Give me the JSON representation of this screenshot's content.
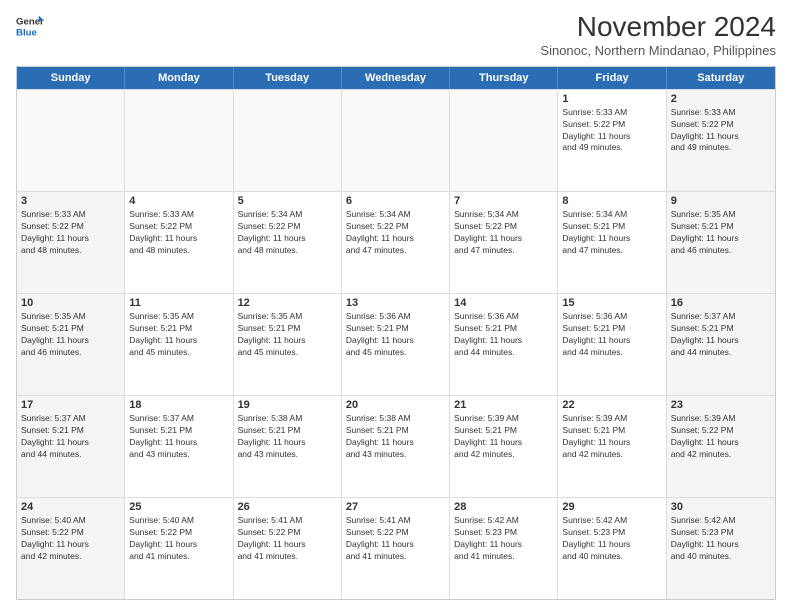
{
  "logo": {
    "line1": "General",
    "line2": "Blue"
  },
  "title": "November 2024",
  "location": "Sinonoc, Northern Mindanao, Philippines",
  "header_days": [
    "Sunday",
    "Monday",
    "Tuesday",
    "Wednesday",
    "Thursday",
    "Friday",
    "Saturday"
  ],
  "weeks": [
    [
      {
        "day": "",
        "info": ""
      },
      {
        "day": "",
        "info": ""
      },
      {
        "day": "",
        "info": ""
      },
      {
        "day": "",
        "info": ""
      },
      {
        "day": "",
        "info": ""
      },
      {
        "day": "1",
        "info": "Sunrise: 5:33 AM\nSunset: 5:22 PM\nDaylight: 11 hours\nand 49 minutes."
      },
      {
        "day": "2",
        "info": "Sunrise: 5:33 AM\nSunset: 5:22 PM\nDaylight: 11 hours\nand 49 minutes."
      }
    ],
    [
      {
        "day": "3",
        "info": "Sunrise: 5:33 AM\nSunset: 5:22 PM\nDaylight: 11 hours\nand 48 minutes."
      },
      {
        "day": "4",
        "info": "Sunrise: 5:33 AM\nSunset: 5:22 PM\nDaylight: 11 hours\nand 48 minutes."
      },
      {
        "day": "5",
        "info": "Sunrise: 5:34 AM\nSunset: 5:22 PM\nDaylight: 11 hours\nand 48 minutes."
      },
      {
        "day": "6",
        "info": "Sunrise: 5:34 AM\nSunset: 5:22 PM\nDaylight: 11 hours\nand 47 minutes."
      },
      {
        "day": "7",
        "info": "Sunrise: 5:34 AM\nSunset: 5:22 PM\nDaylight: 11 hours\nand 47 minutes."
      },
      {
        "day": "8",
        "info": "Sunrise: 5:34 AM\nSunset: 5:21 PM\nDaylight: 11 hours\nand 47 minutes."
      },
      {
        "day": "9",
        "info": "Sunrise: 5:35 AM\nSunset: 5:21 PM\nDaylight: 11 hours\nand 46 minutes."
      }
    ],
    [
      {
        "day": "10",
        "info": "Sunrise: 5:35 AM\nSunset: 5:21 PM\nDaylight: 11 hours\nand 46 minutes."
      },
      {
        "day": "11",
        "info": "Sunrise: 5:35 AM\nSunset: 5:21 PM\nDaylight: 11 hours\nand 45 minutes."
      },
      {
        "day": "12",
        "info": "Sunrise: 5:35 AM\nSunset: 5:21 PM\nDaylight: 11 hours\nand 45 minutes."
      },
      {
        "day": "13",
        "info": "Sunrise: 5:36 AM\nSunset: 5:21 PM\nDaylight: 11 hours\nand 45 minutes."
      },
      {
        "day": "14",
        "info": "Sunrise: 5:36 AM\nSunset: 5:21 PM\nDaylight: 11 hours\nand 44 minutes."
      },
      {
        "day": "15",
        "info": "Sunrise: 5:36 AM\nSunset: 5:21 PM\nDaylight: 11 hours\nand 44 minutes."
      },
      {
        "day": "16",
        "info": "Sunrise: 5:37 AM\nSunset: 5:21 PM\nDaylight: 11 hours\nand 44 minutes."
      }
    ],
    [
      {
        "day": "17",
        "info": "Sunrise: 5:37 AM\nSunset: 5:21 PM\nDaylight: 11 hours\nand 44 minutes."
      },
      {
        "day": "18",
        "info": "Sunrise: 5:37 AM\nSunset: 5:21 PM\nDaylight: 11 hours\nand 43 minutes."
      },
      {
        "day": "19",
        "info": "Sunrise: 5:38 AM\nSunset: 5:21 PM\nDaylight: 11 hours\nand 43 minutes."
      },
      {
        "day": "20",
        "info": "Sunrise: 5:38 AM\nSunset: 5:21 PM\nDaylight: 11 hours\nand 43 minutes."
      },
      {
        "day": "21",
        "info": "Sunrise: 5:39 AM\nSunset: 5:21 PM\nDaylight: 11 hours\nand 42 minutes."
      },
      {
        "day": "22",
        "info": "Sunrise: 5:39 AM\nSunset: 5:21 PM\nDaylight: 11 hours\nand 42 minutes."
      },
      {
        "day": "23",
        "info": "Sunrise: 5:39 AM\nSunset: 5:22 PM\nDaylight: 11 hours\nand 42 minutes."
      }
    ],
    [
      {
        "day": "24",
        "info": "Sunrise: 5:40 AM\nSunset: 5:22 PM\nDaylight: 11 hours\nand 42 minutes."
      },
      {
        "day": "25",
        "info": "Sunrise: 5:40 AM\nSunset: 5:22 PM\nDaylight: 11 hours\nand 41 minutes."
      },
      {
        "day": "26",
        "info": "Sunrise: 5:41 AM\nSunset: 5:22 PM\nDaylight: 11 hours\nand 41 minutes."
      },
      {
        "day": "27",
        "info": "Sunrise: 5:41 AM\nSunset: 5:22 PM\nDaylight: 11 hours\nand 41 minutes."
      },
      {
        "day": "28",
        "info": "Sunrise: 5:42 AM\nSunset: 5:23 PM\nDaylight: 11 hours\nand 41 minutes."
      },
      {
        "day": "29",
        "info": "Sunrise: 5:42 AM\nSunset: 5:23 PM\nDaylight: 11 hours\nand 40 minutes."
      },
      {
        "day": "30",
        "info": "Sunrise: 5:42 AM\nSunset: 5:23 PM\nDaylight: 11 hours\nand 40 minutes."
      }
    ]
  ]
}
